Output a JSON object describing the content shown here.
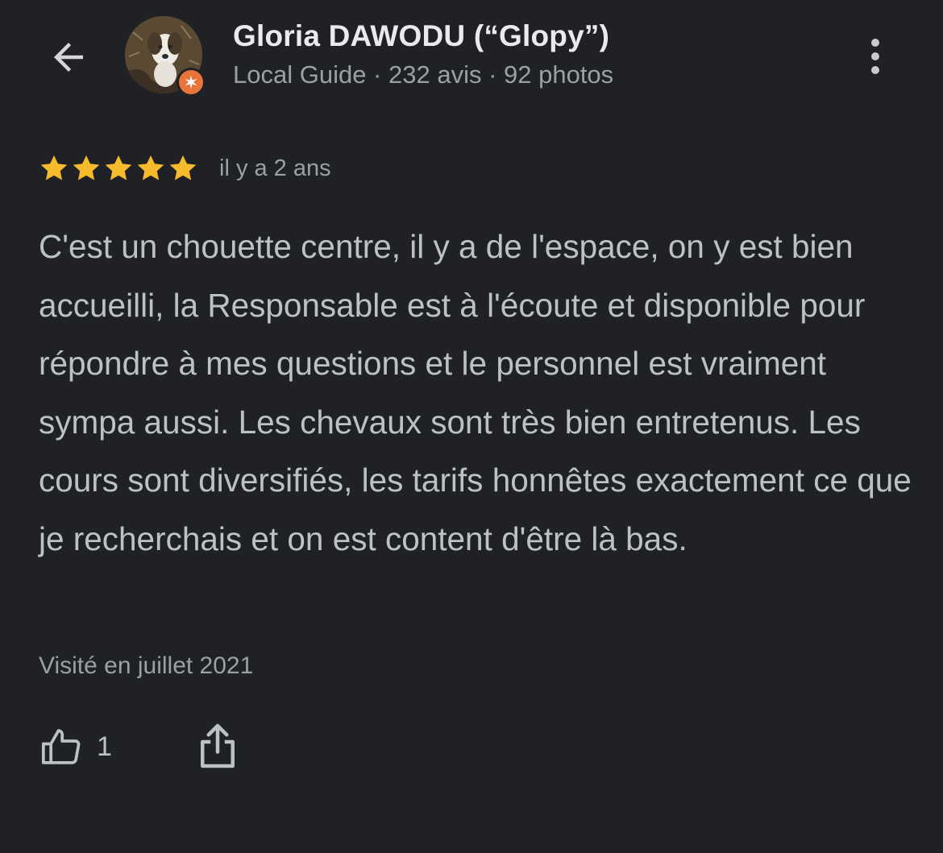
{
  "header": {
    "back_icon": "arrow-left-icon",
    "reviewer_name": "Gloria DAWODU (“Glopy”)",
    "reviewer_meta": "Local Guide · 232 avis · 92 photos",
    "avatar_badge_icon": "local-guide-star-icon",
    "more_icon": "more-vertical-icon"
  },
  "review": {
    "rating": 5,
    "rating_max": 5,
    "date": "il y a 2 ans",
    "text": "C'est un chouette centre, il y a de l'espace, on y est bien accueilli, la Responsable est à l'écoute et disponible pour répondre à mes questions et le personnel est vraiment sympa aussi. Les chevaux sont très bien entretenus. Les cours sont diversifiés, les tarifs honnêtes exactement ce que je recherchais et on est content d'être là bas.",
    "visited": "Visité en juillet 2021"
  },
  "actions": {
    "like_icon": "thumbs-up-icon",
    "like_count": "1",
    "share_icon": "share-icon"
  },
  "colors": {
    "background": "#202124",
    "star": "#f6bb2d",
    "badge": "#e8743b",
    "primary_text": "#e8eaed",
    "secondary_text": "#9aa0a6"
  }
}
